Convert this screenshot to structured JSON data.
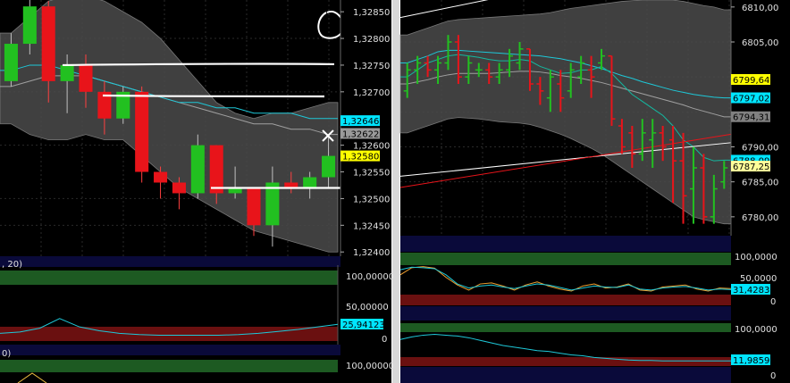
{
  "left_chart": {
    "price_axis": [
      "1,32850",
      "1,32800",
      "1,32750",
      "1,32700",
      "1,32600",
      "1,32550",
      "1,32500",
      "1,32450",
      "1,32400"
    ],
    "price_ylim": [
      1.32392,
      1.32872
    ],
    "tags": [
      {
        "text": "1,32646",
        "value": 1.32646,
        "bg": "#00e5ff",
        "fg": "#000000"
      },
      {
        "text": "1,32622",
        "value": 1.32622,
        "bg": "#9a9a9a",
        "fg": "#000000"
      },
      {
        "text": "1,32580",
        "value": 1.3258,
        "bg": "#ffff00",
        "fg": "#000000"
      }
    ],
    "candles": [
      {
        "o": 1.3272,
        "h": 1.3281,
        "l": 1.3271,
        "c": 1.3279
      },
      {
        "o": 1.3279,
        "h": 1.3288,
        "l": 1.3277,
        "c": 1.3286
      },
      {
        "o": 1.3286,
        "h": 1.3287,
        "l": 1.3268,
        "c": 1.3272
      },
      {
        "o": 1.3272,
        "h": 1.3277,
        "l": 1.3266,
        "c": 1.3275
      },
      {
        "o": 1.3275,
        "h": 1.3277,
        "l": 1.3267,
        "c": 1.327
      },
      {
        "o": 1.327,
        "h": 1.3272,
        "l": 1.3262,
        "c": 1.3265
      },
      {
        "o": 1.3265,
        "h": 1.3271,
        "l": 1.3264,
        "c": 1.327
      },
      {
        "o": 1.327,
        "h": 1.3271,
        "l": 1.3253,
        "c": 1.3255
      },
      {
        "o": 1.3255,
        "h": 1.3256,
        "l": 1.325,
        "c": 1.3253
      },
      {
        "o": 1.3253,
        "h": 1.3254,
        "l": 1.3248,
        "c": 1.3251
      },
      {
        "o": 1.3251,
        "h": 1.3262,
        "l": 1.325,
        "c": 1.326
      },
      {
        "o": 1.326,
        "h": 1.326,
        "l": 1.3249,
        "c": 1.3251
      },
      {
        "o": 1.3251,
        "h": 1.3256,
        "l": 1.325,
        "c": 1.3252
      },
      {
        "o": 1.3252,
        "h": 1.3252,
        "l": 1.3243,
        "c": 1.3245
      },
      {
        "o": 1.3245,
        "h": 1.3256,
        "l": 1.3241,
        "c": 1.3253
      },
      {
        "o": 1.3253,
        "h": 1.3255,
        "l": 1.3251,
        "c": 1.3252
      },
      {
        "o": 1.3252,
        "h": 1.3255,
        "l": 1.325,
        "c": 1.3254
      },
      {
        "o": 1.3254,
        "h": 1.3262,
        "l": 1.3252,
        "c": 1.3258
      }
    ],
    "band_upper": [
      1.3281,
      1.3284,
      1.3287,
      1.3288,
      1.3288,
      1.3287,
      1.3285,
      1.3283,
      1.328,
      1.3276,
      1.3272,
      1.3268,
      1.3266,
      1.3265,
      1.3266,
      1.3266,
      1.3267,
      1.3268
    ],
    "band_lower": [
      1.3264,
      1.3262,
      1.3261,
      1.3261,
      1.3262,
      1.3261,
      1.3261,
      1.3258,
      1.3255,
      1.3252,
      1.325,
      1.3248,
      1.3246,
      1.3244,
      1.3243,
      1.3242,
      1.3241,
      1.324
    ],
    "ma_cyan": [
      1.3274,
      1.3275,
      1.3275,
      1.3274,
      1.3273,
      1.3272,
      1.3271,
      1.327,
      1.3269,
      1.3268,
      1.3268,
      1.3267,
      1.3267,
      1.3266,
      1.3266,
      1.3266,
      1.3265,
      1.3265
    ],
    "ma_grey": [
      1.3271,
      1.3272,
      1.3273,
      1.3273,
      1.3273,
      1.3272,
      1.3271,
      1.327,
      1.3269,
      1.3268,
      1.3267,
      1.3266,
      1.3265,
      1.3264,
      1.3264,
      1.3263,
      1.3263,
      1.3262
    ],
    "hlines": [
      1.3275,
      1.32693,
      1.3252
    ],
    "osc1": {
      "label": ", 20)",
      "levels": [
        "100,00000",
        "50,00000",
        "0"
      ],
      "value_text": "25,94123",
      "values": [
        12,
        14,
        20,
        35,
        22,
        16,
        12,
        10,
        9,
        9,
        9,
        9,
        10,
        12,
        15,
        18,
        22,
        26
      ]
    },
    "osc2": {
      "label": "0)",
      "levels": [
        "100,00000"
      ]
    }
  },
  "right_chart": {
    "price_axis": [
      "6810,00",
      "6805,00",
      "6790,00",
      "6785,00",
      "6780,00"
    ],
    "price_ylim": [
      6777.3,
      6811.0
    ],
    "tags": [
      {
        "text": "6799,64",
        "value": 6799.64,
        "bg": "#ffff00",
        "fg": "#000000"
      },
      {
        "text": "6797,02",
        "value": 6797.02,
        "bg": "#00e5ff",
        "fg": "#000000"
      },
      {
        "text": "6794,31",
        "value": 6794.31,
        "bg": "#808080",
        "fg": "#000000"
      },
      {
        "text": "6788,09",
        "value": 6788.09,
        "bg": "#00e5ff",
        "fg": "#000000"
      },
      {
        "text": "6787,25",
        "value": 6787.25,
        "bg": "#ffff99",
        "fg": "#000000"
      }
    ],
    "bars": [
      {
        "o": 6798,
        "h": 6802,
        "l": 6797,
        "c": 6801
      },
      {
        "o": 6801,
        "h": 6803,
        "l": 6799,
        "c": 6802
      },
      {
        "o": 6802,
        "h": 6803,
        "l": 6800,
        "c": 6801
      },
      {
        "o": 6801,
        "h": 6803,
        "l": 6799,
        "c": 6802
      },
      {
        "o": 6802,
        "h": 6806,
        "l": 6801,
        "c": 6805
      },
      {
        "o": 6805,
        "h": 6806,
        "l": 6799,
        "c": 6800
      },
      {
        "o": 6800,
        "h": 6803,
        "l": 6799,
        "c": 6802
      },
      {
        "o": 6801,
        "h": 6802,
        "l": 6800,
        "c": 6801
      },
      {
        "o": 6801,
        "h": 6802,
        "l": 6799,
        "c": 6800
      },
      {
        "o": 6800,
        "h": 6802,
        "l": 6799,
        "c": 6801
      },
      {
        "o": 6801,
        "h": 6804,
        "l": 6800,
        "c": 6803
      },
      {
        "o": 6802,
        "h": 6805,
        "l": 6801,
        "c": 6804
      },
      {
        "o": 6804,
        "h": 6804,
        "l": 6798,
        "c": 6799
      },
      {
        "o": 6799,
        "h": 6800,
        "l": 6796,
        "c": 6798
      },
      {
        "o": 6797,
        "h": 6801,
        "l": 6795,
        "c": 6800
      },
      {
        "o": 6799,
        "h": 6801,
        "l": 6795,
        "c": 6797
      },
      {
        "o": 6798,
        "h": 6802,
        "l": 6797,
        "c": 6801
      },
      {
        "o": 6800,
        "h": 6803,
        "l": 6799,
        "c": 6802
      },
      {
        "o": 6801,
        "h": 6803,
        "l": 6797,
        "c": 6800
      },
      {
        "o": 6802,
        "h": 6804,
        "l": 6801,
        "c": 6803
      },
      {
        "o": 6803,
        "h": 6803,
        "l": 6793,
        "c": 6794
      },
      {
        "o": 6793,
        "h": 6794,
        "l": 6789,
        "c": 6790
      },
      {
        "o": 6792,
        "h": 6793,
        "l": 6787,
        "c": 6789
      },
      {
        "o": 6789,
        "h": 6794,
        "l": 6788,
        "c": 6792
      },
      {
        "o": 6791,
        "h": 6794,
        "l": 6787,
        "c": 6792
      },
      {
        "o": 6792,
        "h": 6793,
        "l": 6788,
        "c": 6790
      },
      {
        "o": 6791,
        "h": 6793,
        "l": 6782,
        "c": 6788
      },
      {
        "o": 6788,
        "h": 6792,
        "l": 6779,
        "c": 6783
      },
      {
        "o": 6784,
        "h": 6790,
        "l": 6779,
        "c": 6787
      },
      {
        "o": 6787,
        "h": 6789,
        "l": 6779,
        "c": 6780
      },
      {
        "o": 6780,
        "h": 6786,
        "l": 6779,
        "c": 6784
      },
      {
        "o": 6785,
        "h": 6788,
        "l": 6784,
        "c": 6787
      }
    ],
    "band_upper": [
      6806,
      6806.5,
      6807,
      6807.5,
      6808,
      6808.2,
      6808.3,
      6808.4,
      6808.5,
      6808.6,
      6808.7,
      6808.8,
      6808.9,
      6809,
      6809.2,
      6809.5,
      6809.8,
      6810,
      6810.2,
      6810.4,
      6810.6,
      6810.8,
      6810.9,
      6811,
      6811,
      6811,
      6811,
      6810.8,
      6810.5,
      6810.2,
      6810,
      6809.6
    ],
    "band_lower": [
      6792,
      6792.5,
      6793,
      6793.5,
      6794,
      6794.2,
      6794.1,
      6794,
      6793.8,
      6793.6,
      6793.5,
      6793.4,
      6793.2,
      6792.8,
      6792.3,
      6791.8,
      6791.2,
      6790.5,
      6789.8,
      6789,
      6788,
      6787,
      6786,
      6785,
      6784,
      6783,
      6782,
      6781,
      6780,
      6779.6,
      6779.3,
      6779
    ],
    "ma_cyan": [
      6802,
      6802.5,
      6803,
      6803.6,
      6803.8,
      6803.8,
      6803.7,
      6803.6,
      6803.5,
      6803.4,
      6803.3,
      6803.2,
      6803.1,
      6803,
      6802.8,
      6802.6,
      6802.3,
      6802,
      6801.6,
      6801.2,
      6800.7,
      6800.2,
      6799.8,
      6799.3,
      6798.9,
      6798.5,
      6798.1,
      6797.8,
      6797.5,
      6797.3,
      6797.1,
      6797
    ],
    "ma_grey": [
      6799,
      6799.3,
      6799.6,
      6800,
      6800.3,
      6800.5,
      6800.5,
      6800.5,
      6800.5,
      6800.6,
      6800.7,
      6800.8,
      6800.8,
      6800.7,
      6800.5,
      6800.2,
      6800,
      6799.8,
      6799.5,
      6799.2,
      6798.8,
      6798.4,
      6798,
      6797.6,
      6797.2,
      6796.8,
      6796.4,
      6796,
      6795.5,
      6795.1,
      6794.7,
      6794.3
    ],
    "ma_fast": [
      6800,
      6801,
      6802,
      6802.5,
      6803,
      6803.2,
      6803,
      6802.8,
      6802.5,
      6802.3,
      6802.3,
      6802.5,
      6802.3,
      6801.5,
      6801,
      6800.5,
      6800.6,
      6801,
      6801,
      6801.5,
      6800.5,
      6799,
      6797.5,
      6796.5,
      6795.5,
      6794.5,
      6793,
      6791,
      6790,
      6788.5,
      6788,
      6788.1
    ],
    "trend_white_top": [
      6808.5,
      6812.2
    ],
    "trend_white_long": [
      6785.8,
      6790.6
    ],
    "trend_red": [
      6784.2,
      6791.8
    ],
    "osc1": {
      "levels": [
        "100,0000",
        "50,0000",
        "0"
      ],
      "value_text": "31,4283",
      "cyan": [
        70,
        75,
        74,
        72,
        60,
        42,
        34,
        38,
        40,
        36,
        33,
        38,
        42,
        40,
        35,
        30,
        34,
        38,
        36,
        35,
        40,
        32,
        30,
        34,
        36,
        37,
        34,
        30,
        32,
        31
      ],
      "orange": [
        60,
        74,
        76,
        73,
        55,
        40,
        30,
        42,
        44,
        38,
        30,
        40,
        46,
        38,
        32,
        28,
        38,
        42,
        34,
        36,
        42,
        30,
        28,
        36,
        38,
        40,
        32,
        28,
        34,
        33
      ]
    },
    "osc2": {
      "levels": [
        "100,0000",
        "0"
      ],
      "value_text": "11,9859",
      "values": [
        62,
        68,
        72,
        74,
        72,
        70,
        66,
        60,
        54,
        48,
        44,
        40,
        36,
        34,
        30,
        26,
        24,
        20,
        18,
        16,
        14,
        13,
        13,
        12,
        12,
        12,
        12,
        12,
        12,
        12
      ]
    }
  },
  "colors": {
    "bull": "#22c020",
    "bear": "#e8141a",
    "band": "#555555",
    "cyan": "#1ec8d8",
    "grey_ma": "#a0a0a0",
    "axis_bg": "#000000",
    "zone_green": "#1d5a22",
    "zone_red": "#6a1010",
    "divider": "#0a0a3a",
    "osc_line": "#3aa0d8",
    "osc_orange": "#f0a030"
  }
}
